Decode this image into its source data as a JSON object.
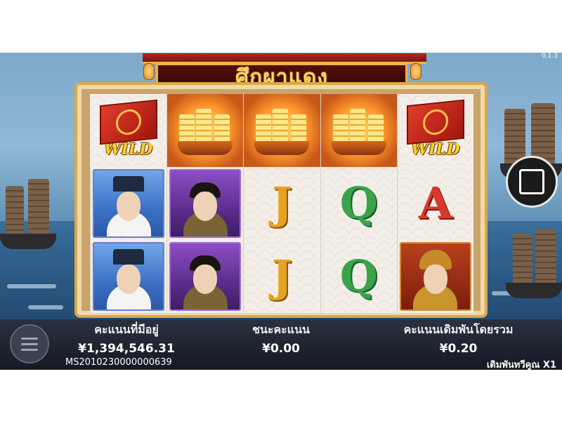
{
  "game": {
    "title": "ศึกผาแดง",
    "version": "0.1.3"
  },
  "reels": {
    "columns": [
      [
        "WILD",
        "strategist",
        "strategist"
      ],
      [
        "golden-ship",
        "warlord",
        "warlord"
      ],
      [
        "golden-ship",
        "J",
        "J"
      ],
      [
        "golden-ship",
        "Q",
        "Q"
      ],
      [
        "WILD",
        "A",
        "general"
      ]
    ],
    "wild_label": "WILD",
    "letters": {
      "J": "J",
      "Q": "Q",
      "A": "A"
    }
  },
  "controls": {
    "stop_icon": "stop-square-icon",
    "menu_icon": "hamburger-icon"
  },
  "stats": {
    "balance_label": "คะแนนที่มีอยู่",
    "balance_value": "¥1,394,546.31",
    "win_label": "ชนะคะแนน",
    "win_value": "¥0.00",
    "bet_label": "คะแนนเดิมพันโดยรวม",
    "bet_value": "¥0.20"
  },
  "footer": {
    "session_id": "MS2010230000000639",
    "bet_multiplier": "เดิมพันทวีคูณ X1"
  },
  "colors": {
    "frame_gold": "#d9a94a",
    "wild_yellow": "#f5d12e",
    "bar_dark": "#141923"
  }
}
